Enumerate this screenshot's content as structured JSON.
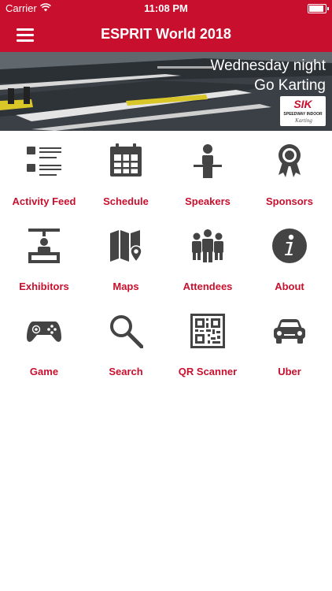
{
  "status_bar": {
    "carrier": "Carrier",
    "time": "11:08 PM",
    "battery_level": 0.9
  },
  "nav": {
    "title": "ESPRIT World 2018"
  },
  "banner": {
    "line1": "Wednesday night",
    "line2": "Go Karting",
    "logo_text": "SIK",
    "logo_subtitle": "SPEEDWAY INDOOR",
    "logo_script": "Karting"
  },
  "colors": {
    "accent": "#c8102e",
    "icon": "#444444",
    "background": "#ffffff"
  },
  "menu": [
    {
      "label": "Activity Feed",
      "icon": "activity-feed-icon"
    },
    {
      "label": "Schedule",
      "icon": "calendar-icon"
    },
    {
      "label": "Speakers",
      "icon": "speaker-icon"
    },
    {
      "label": "Sponsors",
      "icon": "ribbon-icon"
    },
    {
      "label": "Exhibitors",
      "icon": "exhibitor-booth-icon"
    },
    {
      "label": "Maps",
      "icon": "map-icon"
    },
    {
      "label": "Attendees",
      "icon": "people-icon"
    },
    {
      "label": "About",
      "icon": "info-icon"
    },
    {
      "label": "Game",
      "icon": "gamepad-icon"
    },
    {
      "label": "Search",
      "icon": "search-icon"
    },
    {
      "label": "QR Scanner",
      "icon": "qr-code-icon"
    },
    {
      "label": "Uber",
      "icon": "car-icon"
    }
  ]
}
